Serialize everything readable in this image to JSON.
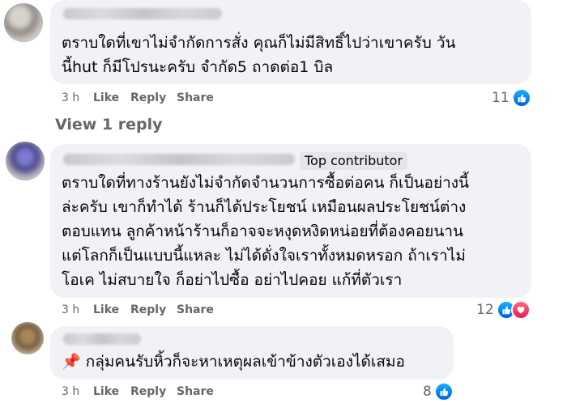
{
  "comments": [
    {
      "name": "",
      "text": "ตราบใดที่เขาไม่จำกัดการสั่ง คุณก็ไม่มีสิทธิ์ไปว่าเขาครับ วัน\nนี้hut ก็มีโปรนะครับ จำกัด5 ถาดต่อ1 บิล",
      "time": "3 h",
      "like_label": "Like",
      "reply_label": "Reply",
      "share_label": "Share",
      "reaction_count": "11",
      "reactions": [
        "like-icon"
      ]
    },
    {
      "name": "",
      "badge": "Top contributor",
      "text": "ตราบใดที่ทางร้านยังไม่จำกัดจำนวนการซื้อต่อคน ก็เป็นอย่างนี้\nล่ะครับ เขาก็ทำได้ ร้านก็ได้ประโยชน์ เหมือนผลประโยชน์ต่าง\nตอบแทน ลูกค้าหน้าร้านก็อาจจะหงุดหงิดหน่อยที่ต้องคอยนาน\nแต่โลกก็เป็นแบบนี้แหละ ไม่ได้ดั่งใจเราทั้งหมดหรอก ถ้าเราไม่\nโอเค ไม่สบายใจ ก็อย่าไปซื้อ อย่าไปคอย แก้ที่ตัวเรา",
      "time": "3 h",
      "like_label": "Like",
      "reply_label": "Reply",
      "share_label": "Share",
      "reaction_count": "12",
      "reactions": [
        "like-icon",
        "love-icon"
      ]
    },
    {
      "name": "",
      "pin_icon": "📌",
      "text": "กลุ่มคนรับหิ้วก็จะหาเหตุผลเข้าข้างตัวเองได้เสมอ",
      "time": "3 h",
      "like_label": "Like",
      "reply_label": "Reply",
      "share_label": "Share",
      "reaction_count": "8",
      "reactions": [
        "like-icon"
      ]
    }
  ],
  "view_replies_label": "View 1 reply",
  "colors": {
    "bubble": "#f0f2f5",
    "meta_text": "#65676b",
    "like_blue": "#0866ff",
    "love_red": "#f33e58"
  }
}
